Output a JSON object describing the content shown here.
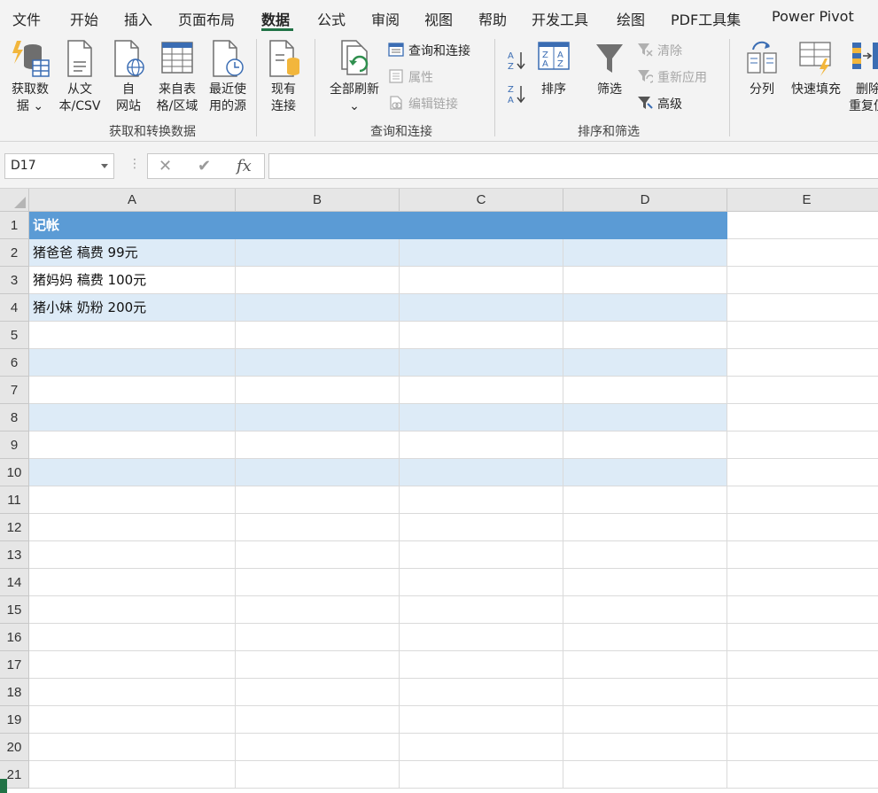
{
  "tabs": [
    "文件",
    "开始",
    "插入",
    "页面布局",
    "数据",
    "公式",
    "审阅",
    "视图",
    "帮助",
    "开发工具",
    "绘图",
    "PDF工具集",
    "Power Pivot"
  ],
  "active_tab": "数据",
  "ribbon": {
    "get_data": {
      "line1": "获取数",
      "line2": "据 ⌄"
    },
    "from_csv": {
      "line1": "从文",
      "line2": "本/CSV"
    },
    "from_web": {
      "line1": "自",
      "line2": "网站"
    },
    "from_table": {
      "line1": "来自表",
      "line2": "格/区域"
    },
    "recent_sources": {
      "line1": "最近使",
      "line2": "用的源"
    },
    "existing_connections": {
      "line1": "现有",
      "line2": "连接"
    },
    "group_get_transform": "获取和转换数据",
    "refresh_all": {
      "line1": "全部刷新",
      "line2": "⌄"
    },
    "queries_connections": "查询和连接",
    "properties": "属性",
    "edit_links": "编辑链接",
    "group_queries": "查询和连接",
    "sort": "排序",
    "filter": "筛选",
    "clear": "清除",
    "reapply": "重新应用",
    "advanced": "高级",
    "group_sort_filter": "排序和筛选",
    "text_to_columns": "分列",
    "flash_fill": "快速填充",
    "remove_duplicates": {
      "line1": "删除",
      "line2": "重复值"
    }
  },
  "formula_bar": {
    "name_box": "D17",
    "formula": "",
    "fx_label": "fx"
  },
  "columns": [
    "A",
    "B",
    "C",
    "D",
    "E"
  ],
  "rows": [
    "1",
    "2",
    "3",
    "4",
    "5",
    "6",
    "7",
    "8",
    "9",
    "10",
    "11",
    "12",
    "13",
    "14",
    "15",
    "16",
    "17",
    "18",
    "19",
    "20",
    "21"
  ],
  "cells": {
    "A1": "记帐",
    "A2": "猪爸爸 稿费 99元",
    "A3": "猪妈妈 稿费 100元",
    "A4": "猪小妹 奶粉 200元"
  },
  "colors": {
    "table_header": "#5b9bd5",
    "table_band": "#ddebf7",
    "tab_accent": "#217346"
  }
}
